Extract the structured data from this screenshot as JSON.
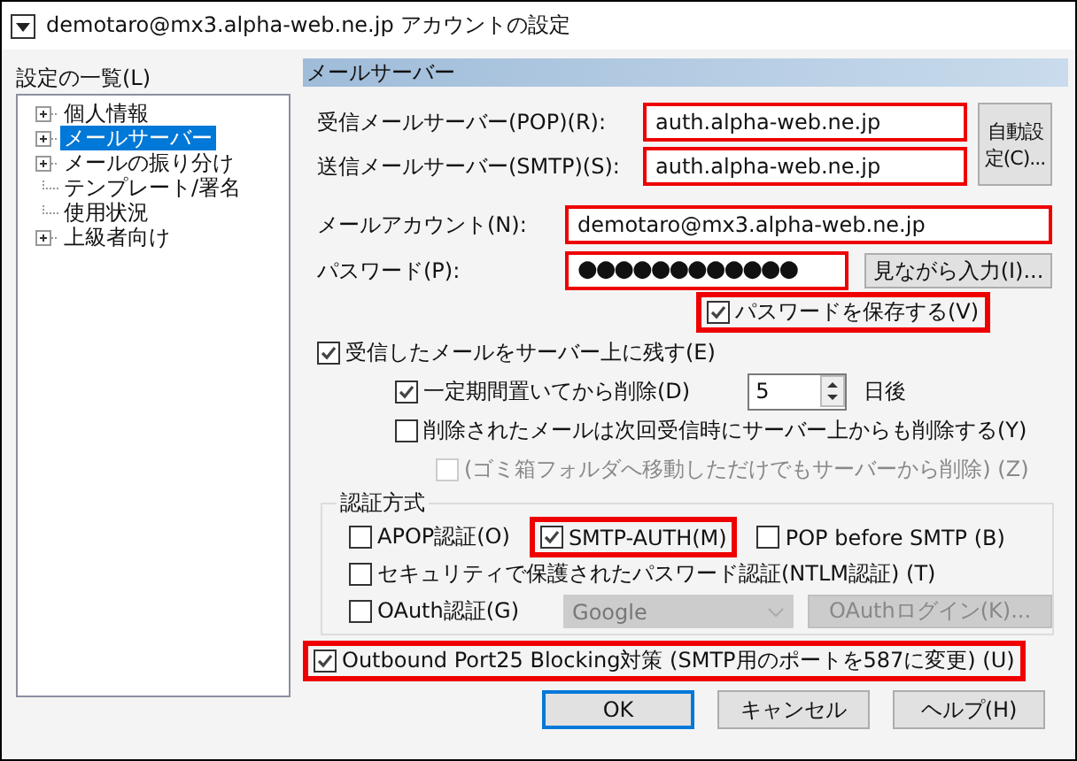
{
  "window": {
    "title": "demotaro@mx3.alpha-web.ne.jp アカウントの設定"
  },
  "sidebar": {
    "label": "設定の一覧(L)",
    "items": [
      {
        "label": "個人情報",
        "kind": "branch",
        "selected": false
      },
      {
        "label": "メールサーバー",
        "kind": "branch",
        "selected": true
      },
      {
        "label": "メールの振り分け",
        "kind": "branch",
        "selected": false
      },
      {
        "label": "テンプレート/署名",
        "kind": "leaf",
        "selected": false
      },
      {
        "label": "使用状況",
        "kind": "leaf",
        "selected": false
      },
      {
        "label": "上級者向け",
        "kind": "branch",
        "selected": false
      }
    ]
  },
  "section_title": "メールサーバー",
  "pop": {
    "label": "受信メールサーバー(POP)(R):",
    "value": "auth.alpha-web.ne.jp",
    "highlighted": true
  },
  "smtp": {
    "label": "送信メールサーバー(SMTP)(S):",
    "value": "auth.alpha-web.ne.jp",
    "highlighted": true
  },
  "auto_button": "自動設定(C)...",
  "account": {
    "label": "メールアカウント(N):",
    "value": "demotaro@mx3.alpha-web.ne.jp",
    "highlighted": true
  },
  "password": {
    "label": "パスワード(P):",
    "value": "●●●●●●●●●●●●",
    "highlighted": true
  },
  "show_button": "見ながら入力(I)...",
  "save_password": {
    "label": "パスワードを保存する(V)",
    "checked": true,
    "highlighted": true
  },
  "options": [
    {
      "label": "受信したメールをサーバー上に残す(E)",
      "checked": true,
      "disabled": false,
      "children": [
        {
          "label": "一定期間置いてから削除(D)",
          "checked": true,
          "disabled": false,
          "spin": {
            "value": "5",
            "unit": "日後"
          }
        },
        {
          "label": "削除されたメールは次回受信時にサーバー上からも削除する(Y)",
          "checked": false,
          "disabled": false,
          "children": [
            {
              "label": "(ゴミ箱フォルダへ移動しただけでもサーバーから削除) (Z)",
              "checked": false,
              "disabled": true
            }
          ]
        }
      ]
    }
  ],
  "auth": {
    "legend": "認証方式",
    "rows": [
      [
        {
          "kind": "checkbox",
          "label": "APOP認証(O)",
          "checked": false,
          "highlighted": false
        },
        {
          "kind": "checkbox",
          "label": "SMTP-AUTH(M)",
          "checked": true,
          "highlighted": true
        },
        {
          "kind": "checkbox",
          "label": "POP before SMTP (B)",
          "checked": false,
          "highlighted": false
        }
      ],
      [
        {
          "kind": "checkbox",
          "label": "セキュリティで保護されたパスワード認証(NTLM認証) (T)",
          "checked": false,
          "highlighted": false
        }
      ],
      [
        {
          "kind": "checkbox",
          "label": "OAuth認証(G)",
          "checked": false,
          "highlighted": false
        },
        {
          "kind": "select",
          "value": "Google",
          "disabled": true
        },
        {
          "kind": "button",
          "label": "OAuthログイン(K)...",
          "disabled": true
        }
      ]
    ]
  },
  "outbound": {
    "label": "Outbound Port25 Blocking対策 (SMTP用のポートを587に変更) (U)",
    "checked": true,
    "highlighted": true
  },
  "buttons": [
    {
      "label": "OK",
      "default": true
    },
    {
      "label": "キャンセル",
      "default": false
    },
    {
      "label": "ヘルプ(H)",
      "default": false
    }
  ]
}
